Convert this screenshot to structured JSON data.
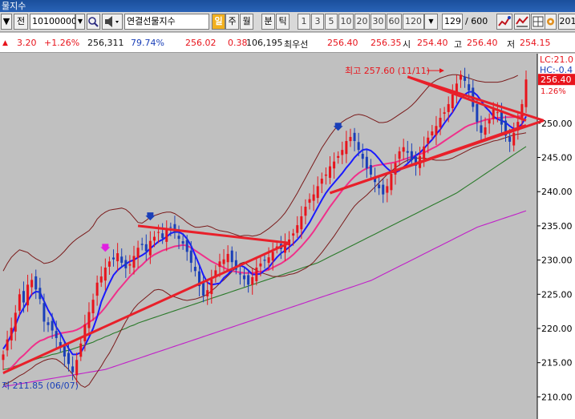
{
  "window": {
    "title": "물지수"
  },
  "toolbar": {
    "dropdown_arrow": "▼",
    "tab_label": "전",
    "code_value": "10100000",
    "search_icon": "search-icon",
    "sound_icon": "speaker-icon",
    "name_value": "연결선물지수",
    "period_buttons": [
      {
        "label": "일",
        "selected": true
      },
      {
        "label": "주",
        "selected": false
      },
      {
        "label": "월",
        "selected": false
      },
      {
        "label": "분",
        "selected": false
      },
      {
        "label": "틱",
        "selected": false
      }
    ],
    "interval_buttons": [
      "1",
      "3",
      "5",
      "10",
      "20",
      "30",
      "60",
      "120"
    ],
    "count_value": "129",
    "count_total": "/ 600",
    "right_label": "201"
  },
  "quote": {
    "change": "3.20",
    "change_pct": "+1.26%",
    "volume": "256,311",
    "volume_ratio": "79.74%",
    "price": "256.02",
    "diff": "0.38",
    "open_interest": "106,195",
    "label_best": "최우선",
    "bid": "256.40",
    "ask": "256.35",
    "open_label": "시",
    "open": "254.40",
    "high_label": "고",
    "high": "256.40",
    "low_label": "저",
    "low": "254.15"
  },
  "chart_data": {
    "type": "candlestick",
    "y_ticks": [
      "250.00",
      "245.00",
      "240.00",
      "235.00",
      "230.00",
      "225.00",
      "220.00",
      "215.00",
      "210.00"
    ],
    "ylim": [
      207,
      259
    ],
    "max_annotation": "최고 257.60 (11/11)",
    "min_annotation": "저 211.85 (06/07)",
    "last_price_label": "256.40",
    "last_pct_label": "1.26%",
    "corner_labels": [
      "LC:21.0",
      "HC:-0.4"
    ],
    "num_candles": 129,
    "closes": [
      216.2,
      218.4,
      220.1,
      222.3,
      225.0,
      223.8,
      226.4,
      227.1,
      225.7,
      224.3,
      221.0,
      220.5,
      219.7,
      218.6,
      217.2,
      215.9,
      214.8,
      213.6,
      215.4,
      217.8,
      220.6,
      222.4,
      224.2,
      226.7,
      227.6,
      228.9,
      229.8,
      230.1,
      231.0,
      229.6,
      228.8,
      229.4,
      230.6,
      231.8,
      232.2,
      231.3,
      232.8,
      233.4,
      234.1,
      233.2,
      234.5,
      234.8,
      234.0,
      233.1,
      232.4,
      231.2,
      229.6,
      228.4,
      226.2,
      224.8,
      225.6,
      227.2,
      228.5,
      229.8,
      230.1,
      230.9,
      229.7,
      228.6,
      227.9,
      227.2,
      226.4,
      227.5,
      228.9,
      229.5,
      229.9,
      230.4,
      231.2,
      232.0,
      231.6,
      232.4,
      233.0,
      233.9,
      235.1,
      236.4,
      237.8,
      238.9,
      239.6,
      240.8,
      241.9,
      242.5,
      243.7,
      244.4,
      245.2,
      246.1,
      247.4,
      248.0,
      247.4,
      246.1,
      244.8,
      243.4,
      242.5,
      241.4,
      240.5,
      239.6,
      240.8,
      242.6,
      244.2,
      245.9,
      246.5,
      245.7,
      244.6,
      243.8,
      245.2,
      246.6,
      247.9,
      248.8,
      249.6,
      250.8,
      251.6,
      252.8,
      254.2,
      255.8,
      257.1,
      256.2,
      254.8,
      252.4,
      250.2,
      248.6,
      249.4,
      250.5,
      252.1,
      251.6,
      249.8,
      248.2,
      247.3,
      248.6,
      250.2,
      252.8,
      256.4
    ],
    "overlays": {
      "bb_upper": [
        228.4,
        229.5,
        230.4,
        231.0,
        231.5,
        231.3,
        231.1,
        230.6,
        230.2,
        229.9,
        229.5,
        229.6,
        229.8,
        230.2,
        230.7,
        231.3,
        232.0,
        232.6,
        233.1,
        233.5,
        233.9,
        234.3,
        235.0,
        236.0,
        236.6,
        237.0,
        237.3,
        237.4,
        237.5,
        237.6,
        237.4,
        236.9,
        236.2,
        235.5,
        235.4,
        235.8,
        236.3,
        236.5,
        236.7,
        236.9,
        237.0,
        237.0,
        236.8,
        236.4,
        236.0,
        235.5,
        235.1,
        234.8,
        234.8,
        234.9,
        235.0,
        234.8,
        234.5,
        234.3,
        234.2,
        234.1,
        233.9,
        233.7,
        233.5,
        233.6,
        233.6,
        233.5,
        233.6,
        233.8,
        234.2,
        234.6,
        235.1,
        235.6,
        236.2,
        236.9,
        237.8,
        238.8,
        239.8,
        240.9,
        242.0,
        243.1,
        244.2,
        245.3,
        246.4,
        247.3,
        248.2,
        249.0,
        249.7,
        250.2,
        250.6,
        250.9,
        251.2,
        251.3,
        251.2,
        251.0,
        250.7,
        250.4,
        250.1,
        250.1,
        250.2,
        250.5,
        250.9,
        251.3,
        251.7,
        252.1,
        252.6,
        253.2,
        253.9,
        254.6,
        255.3,
        255.9,
        256.3,
        256.6,
        256.8,
        257.0,
        257.1,
        257.1,
        257.0,
        256.8,
        256.6,
        256.4,
        256.2,
        256.1,
        256.0,
        256.0,
        256.0,
        256.0,
        256.1,
        256.3,
        256.5,
        256.7,
        257.0
      ],
      "bb_lower": [
        211.8,
        212.0,
        212.3,
        212.7,
        213.1,
        213.4,
        213.8,
        214.2,
        214.7,
        215.0,
        215.3,
        215.5,
        215.6,
        215.5,
        215.1,
        214.6,
        214.0,
        213.3,
        212.4,
        211.7,
        211.4,
        211.8,
        212.7,
        213.6,
        214.5,
        215.5,
        216.4,
        217.5,
        218.7,
        219.9,
        221.0,
        222.0,
        222.9,
        223.6,
        224.1,
        224.6,
        225.1,
        225.6,
        225.7,
        225.6,
        225.2,
        224.8,
        224.6,
        224.4,
        224.2,
        224.1,
        224.2,
        224.3,
        224.5,
        224.7,
        225.0,
        225.5,
        226.0,
        226.6,
        227.1,
        227.7,
        228.3,
        228.9,
        229.5,
        229.7,
        229.2,
        228.8,
        228.5,
        228.2,
        228.0,
        227.8,
        227.6,
        227.6,
        227.6,
        227.7,
        227.9,
        228.0,
        228.2,
        228.5,
        228.8,
        229.2,
        229.7,
        230.4,
        231.1,
        231.9,
        232.7,
        233.5,
        234.4,
        235.3,
        236.2,
        237.1,
        237.9,
        238.5,
        239.0,
        239.5,
        240.1,
        240.7,
        241.3,
        241.9,
        242.5,
        243.0,
        243.5,
        243.9,
        244.3,
        244.6,
        244.8,
        244.9,
        244.9,
        244.9,
        244.8,
        244.7,
        244.6,
        244.6,
        244.6,
        244.7,
        244.9,
        245.2,
        245.5,
        245.8,
        246.1,
        246.4,
        246.6,
        246.8,
        247.0,
        247.2,
        247.4,
        247.5,
        247.7,
        247.9,
        248.1,
        248.3,
        248.4,
        248.5,
        248.6
      ],
      "ma5": [
        217.0,
        217.9,
        219.1,
        220.5,
        222.0,
        223.0,
        224.0,
        225.0,
        225.4,
        225.3,
        224.0,
        222.7,
        221.7,
        220.2,
        219.3,
        218.1,
        217.1,
        216.2,
        216.2,
        216.5,
        217.5,
        218.7,
        220.0,
        221.7,
        223.9,
        225.3,
        226.6,
        227.8,
        228.5,
        229.0,
        229.4,
        229.8,
        230.0,
        230.4,
        230.7,
        231.1,
        231.7,
        232.2,
        232.7,
        233.0,
        233.4,
        233.9,
        234.1,
        234.1,
        233.8,
        233.1,
        232.1,
        230.7,
        229.3,
        227.8,
        226.7,
        226.4,
        226.5,
        226.6,
        227.4,
        227.9,
        228.6,
        229.1,
        229.2,
        229.0,
        228.5,
        227.9,
        227.9,
        228.0,
        228.5,
        228.9,
        229.7,
        230.4,
        231.0,
        231.4,
        231.9,
        232.4,
        233.0,
        233.7,
        234.6,
        235.5,
        236.6,
        237.7,
        238.8,
        239.8,
        240.6,
        241.3,
        242.0,
        242.7,
        243.5,
        244.2,
        245.0,
        245.6,
        246.1,
        246.2,
        246.0,
        245.5,
        244.8,
        244.0,
        243.4,
        242.9,
        242.8,
        243.1,
        243.6,
        244.1,
        244.7,
        245.3,
        245.7,
        246.3,
        247.0,
        247.6,
        248.4,
        249.1,
        250.0,
        250.8,
        251.6,
        252.6,
        253.6,
        254.2,
        254.6,
        254.6,
        254.1,
        253.3,
        252.4,
        251.8,
        251.0,
        250.6,
        250.4,
        250.1,
        249.6,
        249.2,
        249.3,
        249.9,
        251.0
      ],
      "ma20": [
        213.4,
        213.8,
        214.3,
        214.9,
        215.6,
        216.1,
        216.7,
        217.3,
        217.8,
        218.2,
        218.4,
        218.7,
        218.9,
        219.1,
        219.3,
        219.4,
        219.5,
        219.6,
        219.8,
        220.1,
        220.5,
        220.9,
        221.3,
        221.8,
        222.4,
        223.1,
        223.9,
        224.7,
        225.5,
        226.2,
        226.9,
        227.6,
        228.2,
        228.8,
        229.3,
        229.9,
        230.4,
        230.8,
        231.1,
        231.4,
        231.6,
        231.8,
        232.0,
        232.1,
        232.2,
        232.1,
        231.8,
        231.4,
        231.0,
        230.6,
        230.2,
        229.8,
        229.5,
        229.2,
        228.9,
        228.6,
        228.4,
        228.3,
        228.2,
        228.1,
        228.1,
        228.1,
        228.2,
        228.3,
        228.4,
        228.6,
        228.9,
        229.2,
        229.5,
        229.9,
        230.3,
        230.8,
        231.4,
        232.0,
        232.7,
        233.4,
        234.2,
        235.1,
        236.0,
        236.9,
        237.8,
        238.6,
        239.4,
        240.2,
        240.9,
        241.6,
        242.2,
        242.7,
        243.1,
        243.4,
        243.6,
        243.8,
        243.9,
        244.0,
        244.1,
        244.2,
        244.3,
        244.5,
        244.7,
        244.9,
        245.1,
        245.3,
        245.5,
        245.7,
        246.0,
        246.3,
        246.6,
        247.0,
        247.4,
        247.8,
        248.2,
        248.6,
        249.0,
        249.4,
        249.7,
        249.9,
        250.1,
        250.3,
        250.5,
        250.6,
        250.7,
        250.8,
        250.8,
        250.9,
        250.9,
        250.9,
        251.0,
        251.1,
        251.3
      ],
      "ma60": [
        214.0,
        214.1,
        214.3,
        214.5,
        214.7,
        214.9,
        215.1,
        215.3,
        215.5,
        215.7,
        215.8,
        216.0,
        216.2,
        216.3,
        216.5,
        216.7,
        216.8,
        217.0,
        217.2,
        217.4,
        217.6,
        217.8,
        218.0,
        218.3,
        218.5,
        218.8,
        219.0,
        219.3,
        219.5,
        219.8,
        220.0,
        220.3,
        220.5,
        220.8,
        221.0,
        221.2,
        221.4,
        221.6,
        221.8,
        222.0,
        222.2,
        222.4,
        222.6,
        222.8,
        223.0,
        223.2,
        223.4,
        223.6,
        223.8,
        224.0,
        224.2,
        224.4,
        224.6,
        224.8,
        225.0,
        225.2,
        225.4,
        225.6,
        225.8,
        226.0,
        226.2,
        226.4,
        226.6,
        226.8,
        227.0,
        227.2,
        227.4,
        227.6,
        227.8,
        228.0,
        228.2,
        228.4,
        228.6,
        228.8,
        229.0,
        229.2,
        229.4,
        229.6,
        229.9,
        230.2,
        230.5,
        230.8,
        231.1,
        231.4,
        231.7,
        232.0,
        232.3,
        232.6,
        232.9,
        233.2,
        233.5,
        233.8,
        234.1,
        234.4,
        234.7,
        235.0,
        235.3,
        235.6,
        235.9,
        236.2,
        236.5,
        236.8,
        237.1,
        237.4,
        237.7,
        238.0,
        238.3,
        238.6,
        238.9,
        239.2,
        239.5,
        239.8,
        240.2,
        240.6,
        241.0,
        241.4,
        241.8,
        242.2,
        242.6,
        243.0,
        243.4,
        243.8,
        244.2,
        244.6,
        245.0,
        245.4,
        245.8,
        246.2,
        246.6
      ],
      "ma120": [
        211.5,
        211.6,
        211.7,
        211.8,
        211.9,
        212.0,
        212.1,
        212.2,
        212.3,
        212.4,
        212.5,
        212.6,
        212.7,
        212.8,
        212.9,
        213.0,
        213.1,
        213.2,
        213.3,
        213.4,
        213.5,
        213.6,
        213.7,
        213.8,
        213.9,
        214.0,
        214.2,
        214.4,
        214.6,
        214.8,
        215.0,
        215.2,
        215.4,
        215.6,
        215.8,
        216.0,
        216.2,
        216.4,
        216.6,
        216.8,
        217.0,
        217.2,
        217.4,
        217.6,
        217.8,
        218.0,
        218.2,
        218.4,
        218.6,
        218.8,
        219.0,
        219.2,
        219.4,
        219.6,
        219.8,
        220.0,
        220.2,
        220.4,
        220.6,
        220.8,
        221.0,
        221.2,
        221.4,
        221.6,
        221.8,
        222.0,
        222.2,
        222.4,
        222.6,
        222.8,
        223.0,
        223.2,
        223.4,
        223.6,
        223.8,
        224.0,
        224.2,
        224.4,
        224.6,
        224.8,
        225.0,
        225.2,
        225.4,
        225.6,
        225.8,
        226.0,
        226.2,
        226.4,
        226.6,
        226.8,
        227.0,
        227.3,
        227.6,
        227.9,
        228.2,
        228.5,
        228.8,
        229.1,
        229.4,
        229.7,
        230.0,
        230.3,
        230.6,
        230.9,
        231.2,
        231.5,
        231.8,
        232.1,
        232.4,
        232.7,
        233.0,
        233.3,
        233.6,
        233.9,
        234.2,
        234.5,
        234.8,
        235.0,
        235.2,
        235.4,
        235.6,
        235.8,
        236.0,
        236.2,
        236.4,
        236.6,
        236.8,
        237.0,
        237.2
      ]
    },
    "trendlines": [
      {
        "from": [
          0,
          213.5
        ],
        "to": [
          70,
          232.5
        ]
      },
      {
        "from": [
          33,
          235.0
        ],
        "to": [
          70,
          232.5
        ]
      },
      {
        "from": [
          80,
          239.8
        ],
        "to": [
          128,
          249.7
        ]
      },
      {
        "from": [
          99,
          256.8
        ],
        "to": [
          128,
          250.4
        ]
      }
    ],
    "colors": {
      "up": "#e8141c",
      "down": "#1a3fb8",
      "bg": "#c0c0c0",
      "trend": "#e8202a"
    }
  }
}
